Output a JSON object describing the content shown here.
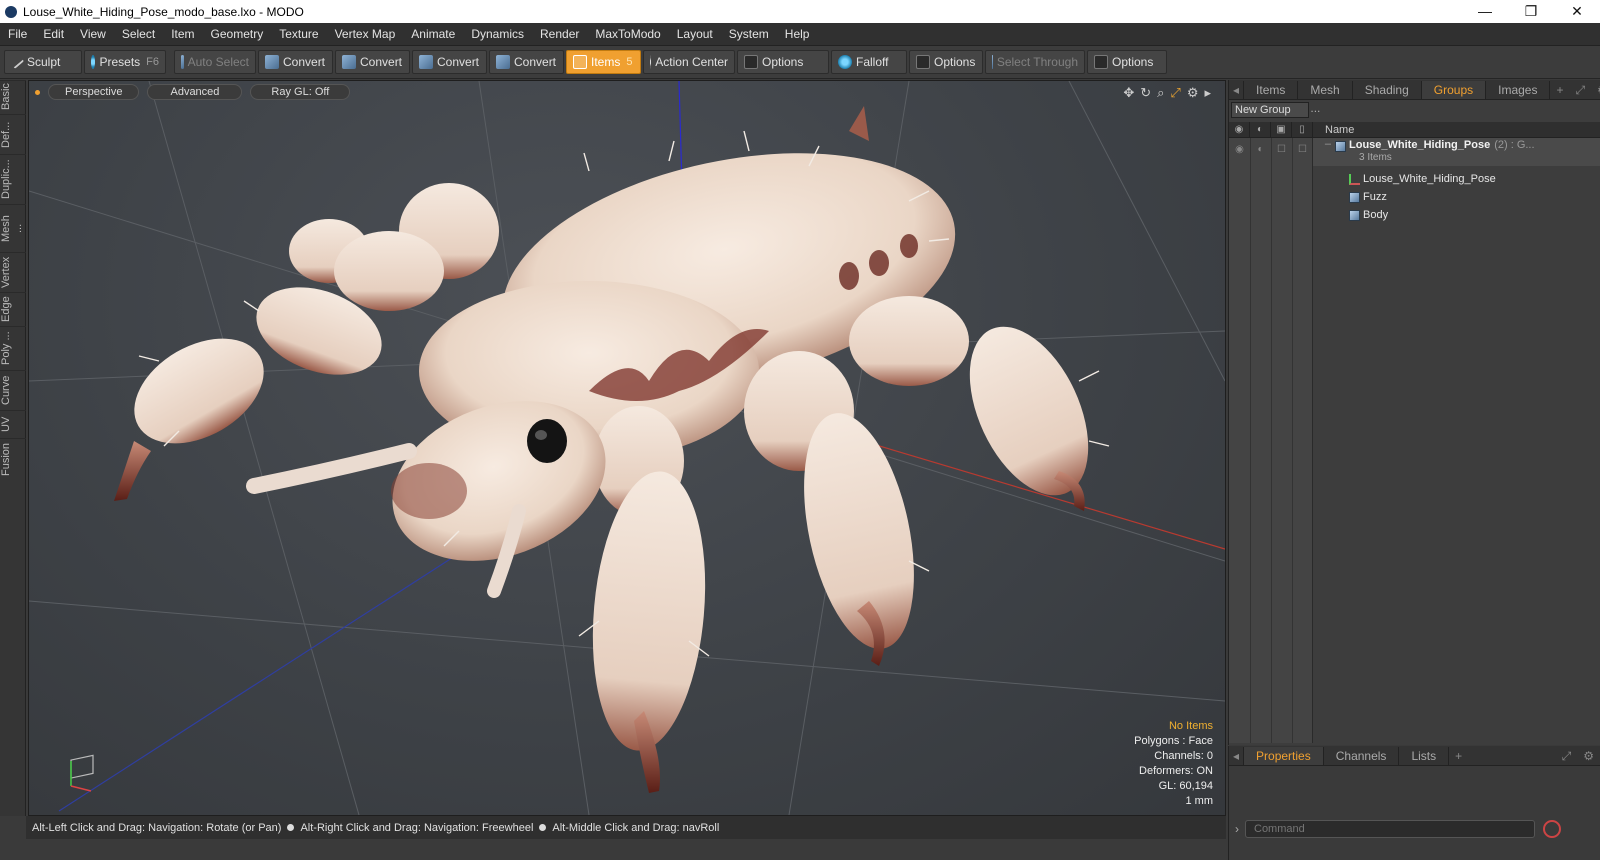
{
  "window": {
    "title": "Louse_White_Hiding_Pose_modo_base.lxo - MODO",
    "minimize": "—",
    "restore": "❐",
    "close": "✕"
  },
  "menu": [
    "File",
    "Edit",
    "View",
    "Select",
    "Item",
    "Geometry",
    "Texture",
    "Vertex Map",
    "Animate",
    "Dynamics",
    "Render",
    "MaxToModo",
    "Layout",
    "System",
    "Help"
  ],
  "toolbar": {
    "sculpt": "Sculpt",
    "presets": "Presets",
    "presets_key": "F6",
    "auto_select": "Auto Select",
    "convert": "Convert",
    "items": "Items",
    "items_key": "5",
    "action_center": "Action Center",
    "options": "Options",
    "falloff": "Falloff",
    "select_through": "Select Through"
  },
  "left_tabs": [
    "Basic",
    "Def...",
    "Duplic...",
    "Mesh ...",
    "Vertex",
    "Edge",
    "Poly ...",
    "Curve",
    "UV",
    "Fusion"
  ],
  "viewport": {
    "view": "Perspective",
    "shading": "Advanced",
    "raygl": "Ray GL: Off",
    "hud": {
      "selection": "No Items",
      "polygons": "Polygons : Face",
      "channels": "Channels: 0",
      "deformers": "Deformers: ON",
      "gl": "GL: 60,194",
      "scale": "1 mm"
    }
  },
  "status": {
    "rotate": "Alt-Left Click and Drag: Navigation: Rotate (or Pan)",
    "freewheel": "Alt-Right Click and Drag: Navigation: Freewheel",
    "navroll": "Alt-Middle Click and Drag: navRoll"
  },
  "right_panel": {
    "tabs": [
      "Items",
      "Mesh ...",
      "Shading",
      "Groups",
      "Images"
    ],
    "active_tab": "Groups",
    "plus": "+",
    "new_group": "New Group",
    "name_header": "Name",
    "group": {
      "name": "Louse_White_Hiding_Pose",
      "suffix": "(2) : G...",
      "count": "3 Items"
    },
    "children": [
      "Louse_White_Hiding_Pose",
      "Fuzz",
      "Body"
    ]
  },
  "bottom_panel": {
    "tabs": [
      "Properties",
      "Channels",
      "Lists"
    ],
    "active_tab": "Properties",
    "plus": "+",
    "command_placeholder": "Command"
  },
  "colors": {
    "accent": "#f0a030",
    "viewport_bg": "#3e4247",
    "panel_bg": "#3d3d3d"
  }
}
